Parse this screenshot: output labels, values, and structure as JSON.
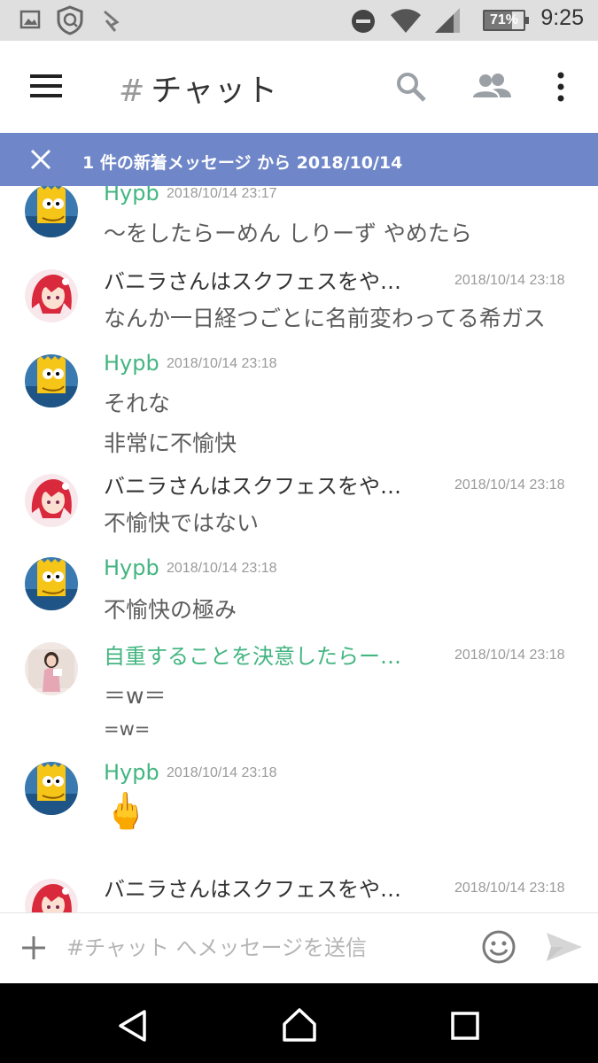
{
  "status_bar": {
    "time": "9:25",
    "battery": "71%",
    "icons": [
      "image-icon",
      "shield-icon",
      "download-icon",
      "dnd-icon",
      "wifi-icon",
      "signal-icon",
      "battery-icon"
    ]
  },
  "toolbar": {
    "hash": "#",
    "channel_name": "チャット",
    "icons": [
      "menu-icon",
      "search-icon",
      "members-icon",
      "more-icon"
    ]
  },
  "banner": {
    "text": "1 件の新着メッセージ から 2018/10/14"
  },
  "messages": [
    {
      "author": "Hypb",
      "author_color": "#43b581",
      "avatar": "bart-avatar",
      "timestamp": "2018/10/14 23:17",
      "lines": [
        "〜をしたらーめん しりーず やめたら"
      ]
    },
    {
      "author": "バニラさんはスクフェスをや…",
      "author_color": "#333333",
      "avatar": "anime-red-hair-avatar",
      "timestamp": "2018/10/14 23:18",
      "lines": [
        "なんか一日経つごとに名前変わってる希ガス"
      ]
    },
    {
      "author": "Hypb",
      "author_color": "#43b581",
      "avatar": "bart-avatar",
      "timestamp": "2018/10/14 23:18",
      "lines": [
        "それな",
        "非常に不愉快"
      ]
    },
    {
      "author": "バニラさんはスクフェスをや…",
      "author_color": "#333333",
      "avatar": "anime-red-hair-avatar",
      "timestamp": "2018/10/14 23:18",
      "lines": [
        "不愉快ではない"
      ]
    },
    {
      "author": "Hypb",
      "author_color": "#43b581",
      "avatar": "bart-avatar",
      "timestamp": "2018/10/14 23:18",
      "lines": [
        "不愉快の極み"
      ]
    },
    {
      "author": "自重することを決意したらー…",
      "author_color": "#43b581",
      "avatar": "photo-avatar",
      "timestamp": "2018/10/14 23:18",
      "lines": [
        "＝w＝",
        "=w="
      ]
    },
    {
      "author": "Hypb",
      "author_color": "#43b581",
      "avatar": "bart-avatar",
      "timestamp": "2018/10/14 23:18",
      "lines": [
        "🖕"
      ]
    },
    {
      "author": "バニラさんはスクフェスをや…",
      "author_color": "#333333",
      "avatar": "anime-red-hair-avatar",
      "timestamp": "2018/10/14 23:18",
      "lines": []
    }
  ],
  "input": {
    "placeholder": "#チャット へメッセージを送信",
    "value": ""
  },
  "nav": [
    "back-icon",
    "home-icon",
    "recents-icon"
  ],
  "colors": {
    "banner": "#6f87c9",
    "green_author": "#43b581",
    "status_bar": "#dfdfdf"
  }
}
